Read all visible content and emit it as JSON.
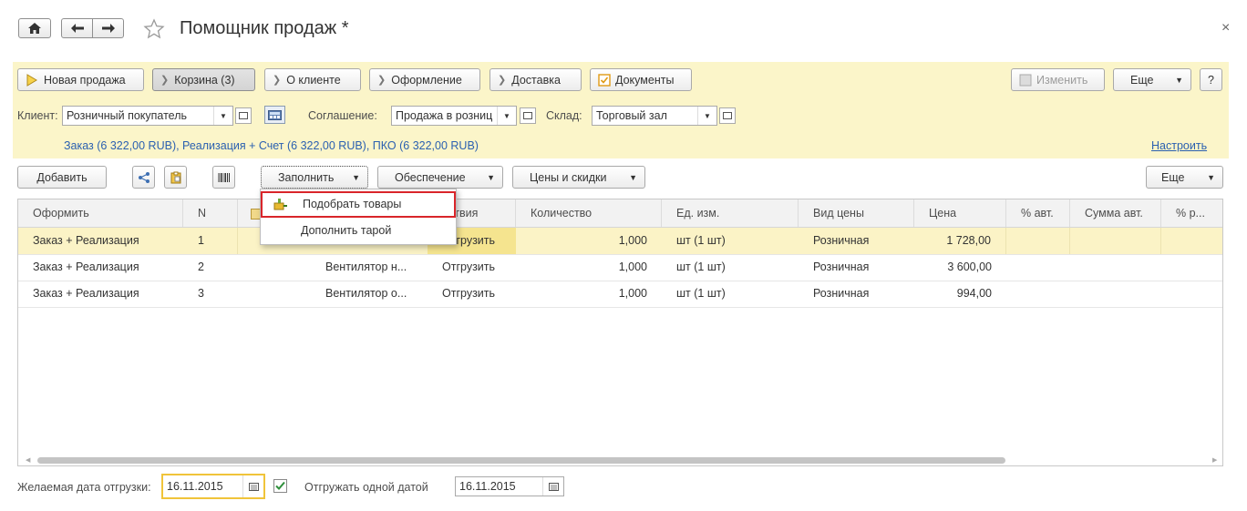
{
  "window": {
    "title": "Помощник продаж *",
    "close": "×"
  },
  "toolbar": {
    "new_sale": "Новая продажа",
    "cart": "Корзина (3)",
    "about_client": "О клиенте",
    "design": "Оформление",
    "delivery": "Доставка",
    "documents": "Документы",
    "edit": "Изменить",
    "more": "Еще",
    "help": "?"
  },
  "form": {
    "client_label": "Клиент:",
    "client_value": "Розничный покупатель",
    "agreement_label": "Соглашение:",
    "agreement_value": "Продажа в розниц",
    "warehouse_label": "Склад:",
    "warehouse_value": "Торговый зал",
    "summary": "Заказ (6 322,00 RUB), Реализация + Счет (6 322,00 RUB), ПКО (6 322,00 RUB)",
    "configure": "Настроить"
  },
  "tabletoolbar": {
    "add": "Добавить",
    "fill": "Заполнить",
    "provision": "Обеспечение",
    "prices": "Цены и скидки",
    "more": "Еще"
  },
  "menu": {
    "items": [
      "Подобрать товары",
      "Дополнить тарой"
    ]
  },
  "table": {
    "headers": [
      "Оформить",
      "N",
      "",
      "",
      "йствия",
      "Количество",
      "Ед. изм.",
      "Вид цены",
      "Цена",
      "% авт.",
      "Сумма авт.",
      "% р..."
    ],
    "rows": [
      {
        "doc": "Заказ + Реализация",
        "n": "1",
        "item": "",
        "action": "Отгрузить",
        "qty": "1,000",
        "unit": "шт (1 шт)",
        "price_type": "Розничная",
        "price": "1 728,00"
      },
      {
        "doc": "Заказ + Реализация",
        "n": "2",
        "item": "Вентилятор н...",
        "action": "Отгрузить",
        "qty": "1,000",
        "unit": "шт (1 шт)",
        "price_type": "Розничная",
        "price": "3 600,00"
      },
      {
        "doc": "Заказ + Реализация",
        "n": "3",
        "item": "Вентилятор о...",
        "action": "Отгрузить",
        "qty": "1,000",
        "unit": "шт (1 шт)",
        "price_type": "Розничная",
        "price": "994,00"
      }
    ]
  },
  "footer": {
    "desired_date_label": "Желаемая дата отгрузки:",
    "desired_date": "16.11.2015",
    "one_date_label": "Отгружать одной датой",
    "one_date": "16.11.2015"
  },
  "colors": {
    "yellow_panel": "#fbf5c9",
    "highlight": "#d9252a",
    "link": "#2b60b0",
    "selected_row": "#fbf3c6"
  }
}
